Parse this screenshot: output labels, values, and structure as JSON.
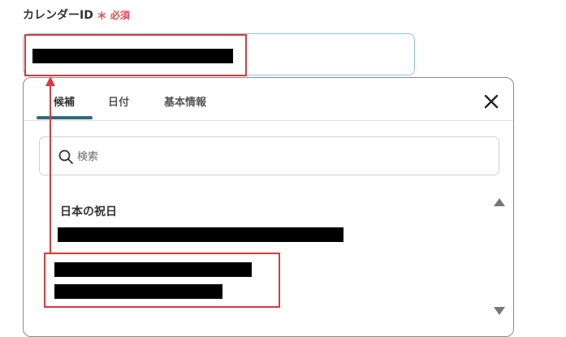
{
  "field": {
    "label": "カレンダーID",
    "required_mark": "＊",
    "required_text": "必須"
  },
  "dropdown": {
    "tabs": [
      {
        "label": "候補",
        "active": true
      },
      {
        "label": "日付",
        "active": false
      },
      {
        "label": "基本情報",
        "active": false
      }
    ],
    "search": {
      "placeholder": "検索",
      "value": ""
    },
    "group_title": "日本の祝日"
  },
  "colors": {
    "required": "#e5484d",
    "highlight": "#d93a3a",
    "tab_underline": "#2e6b7e",
    "input_border": "#8fc3e8"
  },
  "icons": [
    "close-icon",
    "search-icon",
    "scroll-up-icon",
    "scroll-down-icon"
  ]
}
